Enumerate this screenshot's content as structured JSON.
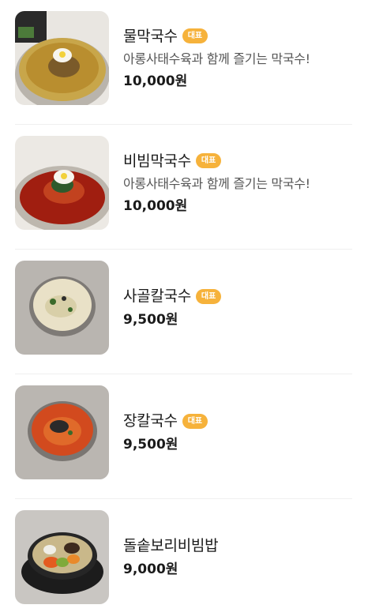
{
  "menu": {
    "items": [
      {
        "name": "물막국수",
        "badge": "대표",
        "description": "아롱사태수육과 함께 즐기는 막국수!",
        "price": "10,000원",
        "image": "mul-makguksu"
      },
      {
        "name": "비빔막국수",
        "badge": "대표",
        "description": "아롱사태수육과 함께 즐기는 막국수!",
        "price": "10,000원",
        "image": "bibim-makguksu"
      },
      {
        "name": "사골칼국수",
        "badge": "대표",
        "price": "9,500원",
        "image": "sagol-kalguksu"
      },
      {
        "name": "장칼국수",
        "badge": "대표",
        "price": "9,500원",
        "image": "jang-kalguksu"
      },
      {
        "name": "돌솥보리비빔밥",
        "price": "9,000원",
        "image": "dolsot-bori-bibimbap"
      }
    ]
  },
  "colors": {
    "badge": "#f6b23b",
    "divider": "#efefef",
    "text": "#1a1a1a",
    "description": "#555555"
  }
}
